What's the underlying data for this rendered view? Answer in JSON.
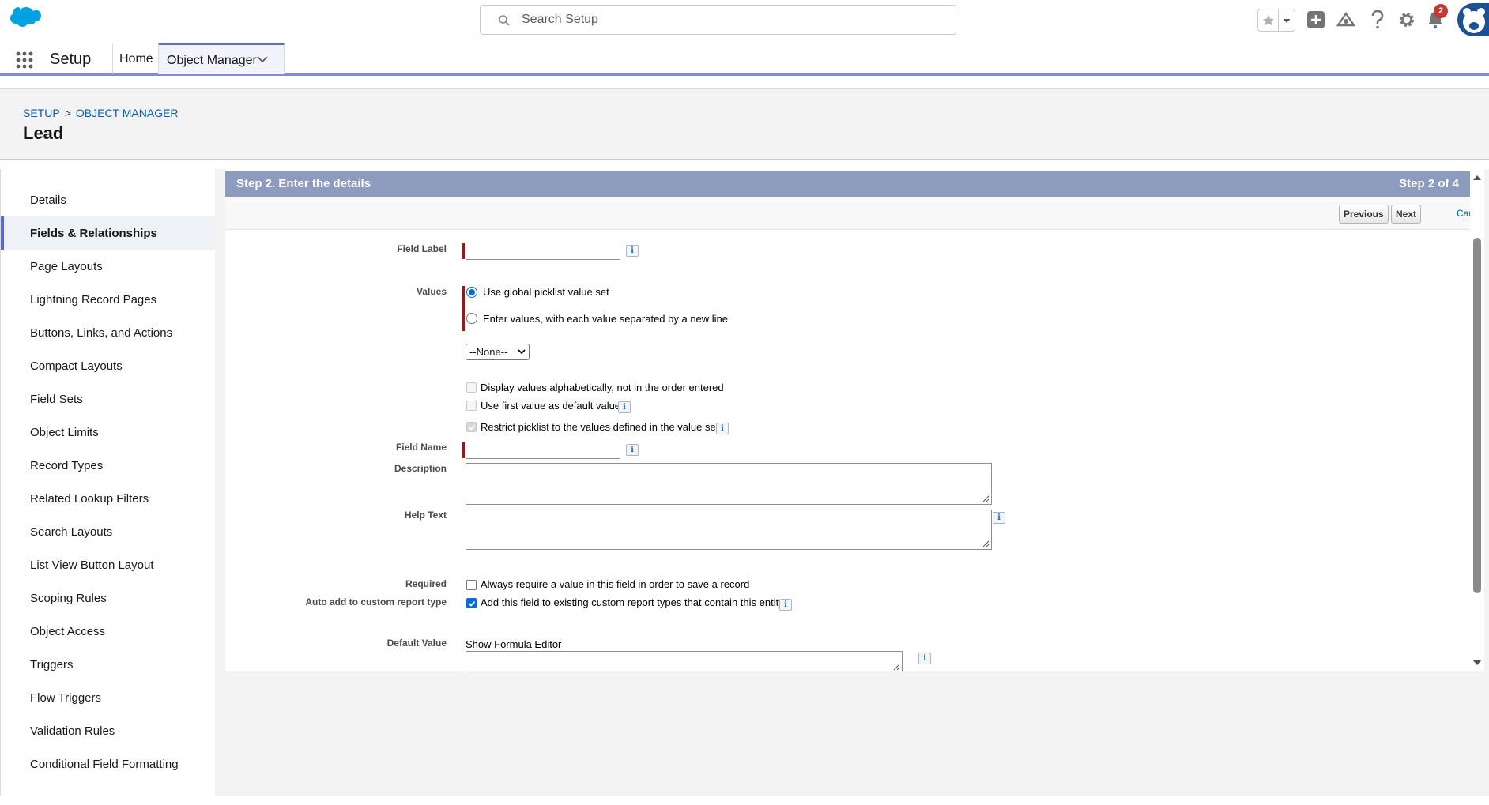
{
  "header": {
    "search_placeholder": "Search Setup",
    "notification_count": "2"
  },
  "nav": {
    "app_name": "Setup",
    "home": "Home",
    "object_manager": "Object Manager"
  },
  "page": {
    "breadcrumb": [
      "SETUP",
      "OBJECT MANAGER"
    ],
    "breadcrumb_sep": ">",
    "title": "Lead"
  },
  "sidebar": {
    "items": [
      {
        "label": "Details"
      },
      {
        "label": "Fields & Relationships",
        "active": true
      },
      {
        "label": "Page Layouts"
      },
      {
        "label": "Lightning Record Pages"
      },
      {
        "label": "Buttons, Links, and Actions"
      },
      {
        "label": "Compact Layouts"
      },
      {
        "label": "Field Sets"
      },
      {
        "label": "Object Limits"
      },
      {
        "label": "Record Types"
      },
      {
        "label": "Related Lookup Filters"
      },
      {
        "label": "Search Layouts"
      },
      {
        "label": "List View Button Layout"
      },
      {
        "label": "Scoping Rules"
      },
      {
        "label": "Object Access"
      },
      {
        "label": "Triggers"
      },
      {
        "label": "Flow Triggers"
      },
      {
        "label": "Validation Rules"
      },
      {
        "label": "Conditional Field Formatting"
      }
    ]
  },
  "form": {
    "step_title": "Step 2. Enter the details",
    "step_num": "Step 2 of 4",
    "buttons": {
      "previous": "Previous",
      "next": "Next",
      "cancel": "Cancel"
    },
    "field_label": {
      "label": "Field Label",
      "value": ""
    },
    "values": {
      "label": "Values",
      "option_global": "Use global picklist value set",
      "option_enter": "Enter values, with each value separated by a new line",
      "selected": "global",
      "select_value": "--None--"
    },
    "checkboxes": {
      "alpha": "Display values alphabetically, not in the order entered",
      "first_default": "Use first value as default value",
      "restrict": "Restrict picklist to the values defined in the value set"
    },
    "field_name": {
      "label": "Field Name",
      "value": ""
    },
    "description": {
      "label": "Description",
      "value": ""
    },
    "help_text": {
      "label": "Help Text",
      "value": ""
    },
    "required": {
      "label": "Required",
      "text": "Always require a value in this field in order to save a record",
      "checked": false
    },
    "auto_add": {
      "label": "Auto add to custom report type",
      "text": "Add this field to existing custom report types that contain this entity",
      "checked": true
    },
    "default_value": {
      "label": "Default Value",
      "link": "Show Formula Editor"
    },
    "info_glyph": "i"
  },
  "colors": {
    "accent": "#5a6ad6",
    "step_bar": "#8d9bbf",
    "required": "#cc0000",
    "link": "#0b5cab",
    "brand_cloud": "#00a1e0"
  }
}
